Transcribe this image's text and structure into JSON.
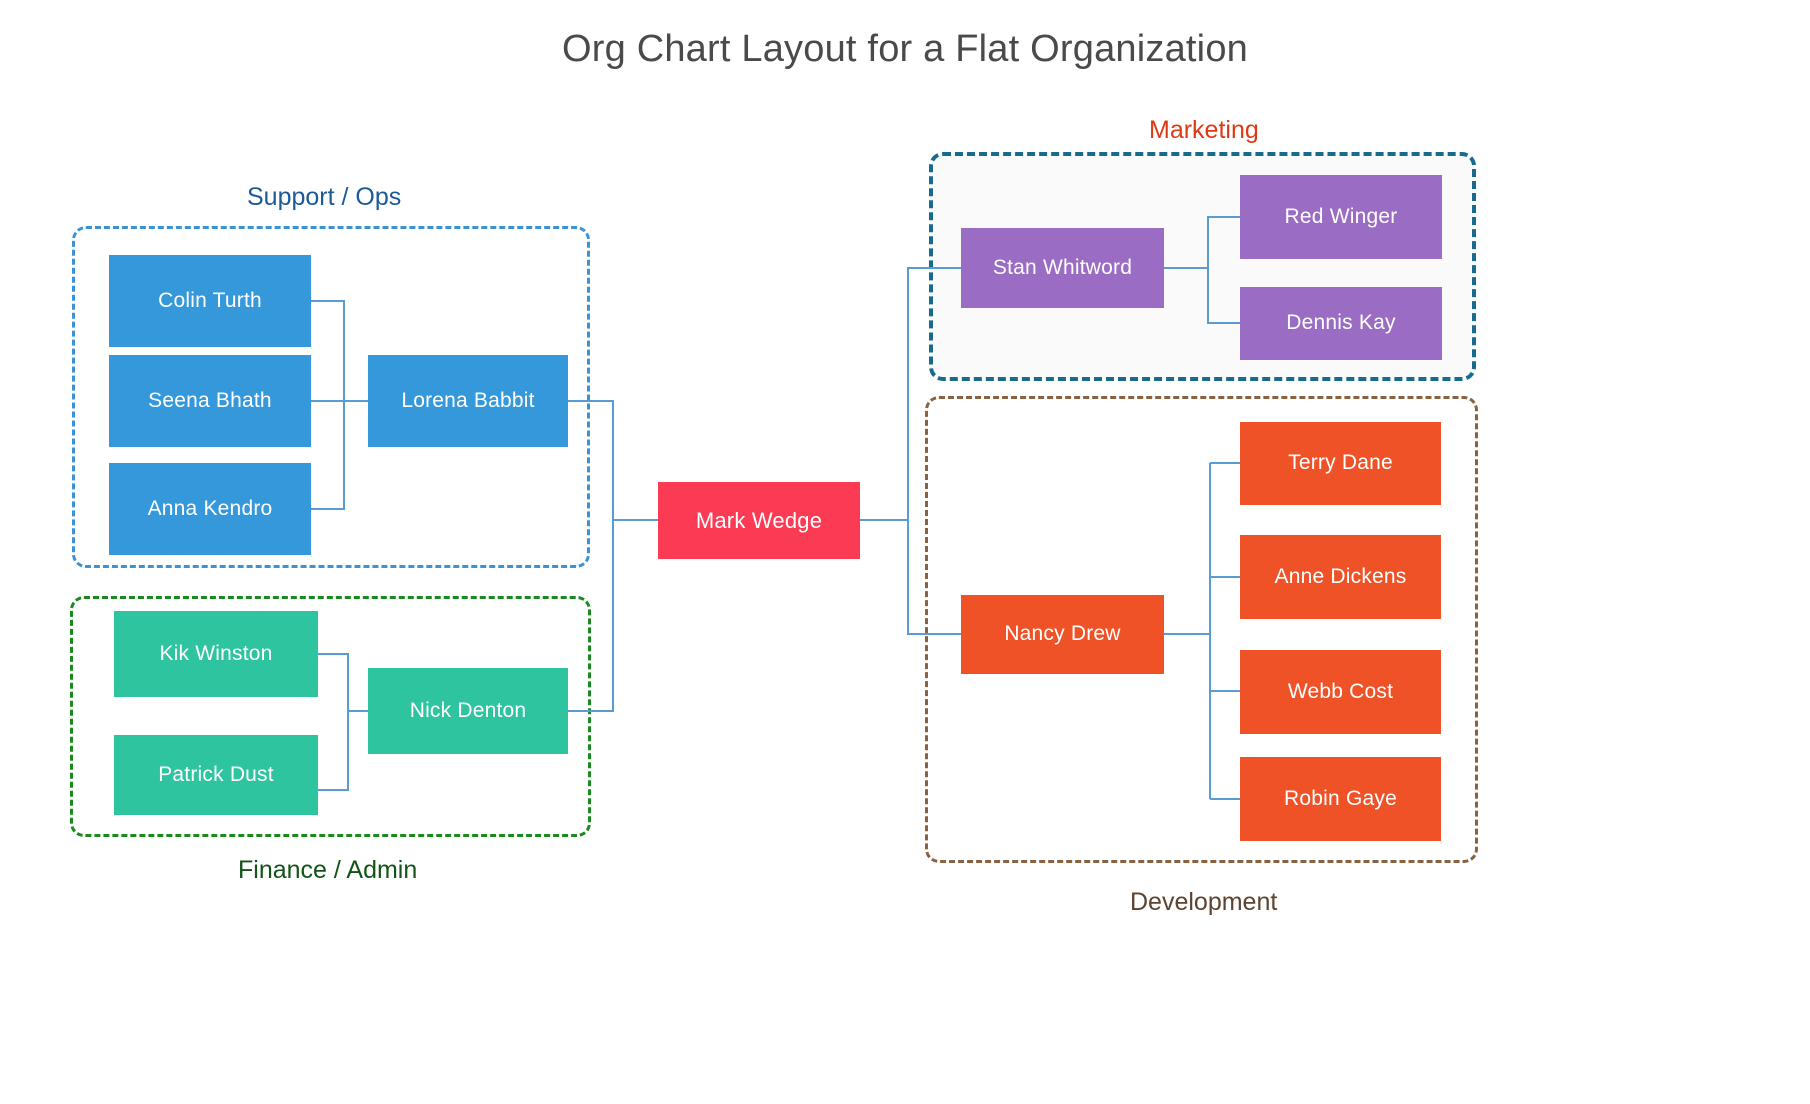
{
  "title": "Org Chart Layout for a Flat Organization",
  "colors": {
    "blue": "#3498db",
    "green": "#2ec4a0",
    "red": "#fb3b53",
    "purple": "#9b6cc4",
    "orange": "#ef5227",
    "connector": "#5b9bd5",
    "title_text": "#4a4a4a",
    "support_label": "#1a5a96",
    "support_border": "#3b93d6",
    "finance_label": "#125417",
    "finance_border": "#1a8a1f",
    "marketing_label": "#e03a14",
    "marketing_border": "#176b8e",
    "development_label": "#5d4330",
    "development_border": "#8a6240"
  },
  "root": {
    "name": "Mark Wedge"
  },
  "groups": [
    {
      "id": "support",
      "label": "Support / Ops",
      "label_position": "top",
      "lead": {
        "name": "Lorena Babbit"
      },
      "members": [
        {
          "name": "Colin Turth"
        },
        {
          "name": "Seena Bhath"
        },
        {
          "name": "Anna Kendro"
        }
      ]
    },
    {
      "id": "finance",
      "label": "Finance / Admin",
      "label_position": "bottom",
      "lead": {
        "name": "Nick Denton"
      },
      "members": [
        {
          "name": "Kik Winston"
        },
        {
          "name": "Patrick Dust"
        }
      ]
    },
    {
      "id": "marketing",
      "label": "Marketing",
      "label_position": "top",
      "lead": {
        "name": "Stan Whitword"
      },
      "members": [
        {
          "name": "Red Winger"
        },
        {
          "name": "Dennis Kay"
        }
      ]
    },
    {
      "id": "development",
      "label": "Development",
      "label_position": "bottom",
      "lead": {
        "name": "Nancy Drew"
      },
      "members": [
        {
          "name": "Terry Dane"
        },
        {
          "name": "Anne Dickens"
        },
        {
          "name": "Webb Cost"
        },
        {
          "name": "Robin Gaye"
        }
      ]
    }
  ]
}
